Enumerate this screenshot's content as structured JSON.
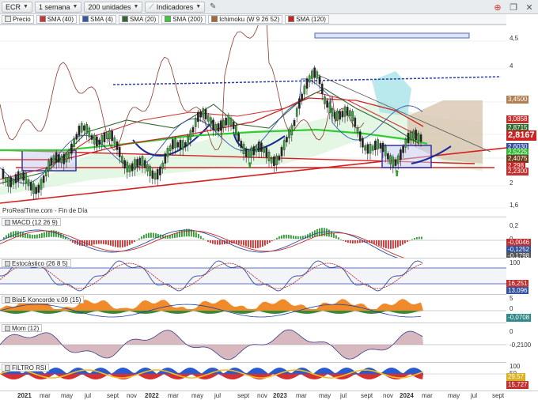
{
  "toolbar": {
    "symbol": "ECR",
    "period": "1 semana",
    "units": "200 unidades",
    "indicators": "Indicadores"
  },
  "legend": [
    {
      "label": "Precio",
      "color": "#e8e8e8"
    },
    {
      "label": "SMA (40)",
      "color": "#cc3333"
    },
    {
      "label": "SMA (4)",
      "color": "#3355aa"
    },
    {
      "label": "SMA (20)",
      "color": "#336633"
    },
    {
      "label": "SMA (200)",
      "color": "#33cc33"
    },
    {
      "label": "Ichimoku (W 9 26 52)",
      "color": "#aa6633"
    },
    {
      "label": "SMA (120)",
      "color": "#cc2222"
    }
  ],
  "price_axis": {
    "ticks": [
      "4,5",
      "4",
      "3,5",
      "3",
      "2,5",
      "2",
      "1,6"
    ],
    "values": [
      {
        "text": "3,4500",
        "color": "#b08050"
      },
      {
        "text": "3,0858",
        "color": "#c03030"
      },
      {
        "text": "2,8715",
        "color": "#2f6a2f"
      },
      {
        "text": "2,8167",
        "color": "#cc2222",
        "big": true
      },
      {
        "text": "2,6030",
        "color": "#3050a0"
      },
      {
        "text": "2,5225",
        "color": "#36b836"
      },
      {
        "text": "2,4075",
        "color": "#6b3f1d"
      },
      {
        "text": "2,298",
        "color": "#d02020"
      },
      {
        "text": "2,2300",
        "color": "#c03030"
      }
    ]
  },
  "watermark": "ProRealTime.com - Fin de Día",
  "macd": {
    "title": "MACD (12 26 9)",
    "ticks": [
      "0,2",
      "0"
    ],
    "values": [
      {
        "text": "-0,0046",
        "color": "#c03030"
      },
      {
        "text": "-0,1252",
        "color": "#3050a0"
      },
      {
        "text": "-0,1798",
        "color": "#555555"
      }
    ]
  },
  "stoch": {
    "title": "Estocástico (26 8 5)",
    "ticks": [
      "100",
      "0"
    ],
    "values": [
      {
        "text": "16,251",
        "color": "#c03030"
      },
      {
        "text": "13,096",
        "color": "#3050a0"
      }
    ]
  },
  "koncorde": {
    "title": "Blai5 Koncorde v.09 (15)",
    "ticks": [
      "5",
      "0"
    ],
    "values": [
      {
        "text": "-0,0708",
        "color": "#2f8a8a"
      }
    ]
  },
  "mom": {
    "title": "Mom (12)",
    "ticks": [
      "0",
      "-0,2100"
    ],
    "values": []
  },
  "rsi": {
    "title": "FILTRO RSI",
    "ticks": [
      "100",
      "50",
      "0"
    ],
    "values": [
      {
        "text": "29,57",
        "color": "#d8b020"
      },
      {
        "text": "15,727",
        "color": "#c03030"
      }
    ]
  },
  "x_axis": [
    "2021",
    "mar",
    "may",
    "jul",
    "sept",
    "nov",
    "2022",
    "mar",
    "may",
    "jul",
    "sept",
    "nov",
    "2023",
    "mar",
    "may",
    "jul",
    "sept",
    "nov",
    "2024",
    "mar",
    "may",
    "jul",
    "sept"
  ],
  "colors": {
    "sma40": "#cc3333",
    "sma4": "#3355aa",
    "sma20": "#336633",
    "sma200": "#33cc33",
    "ichimoku": "#aa6633",
    "sma120": "#cc2222"
  }
}
